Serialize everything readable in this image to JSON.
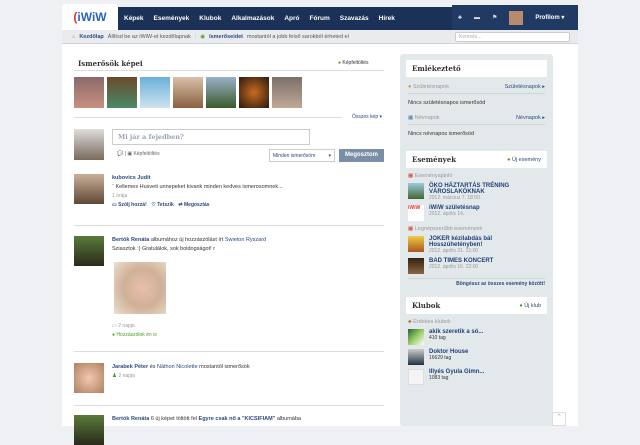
{
  "nav": {
    "logo": "iWiW",
    "items": [
      "Képek",
      "Események",
      "Klubok",
      "Alkalmazások",
      "Apró",
      "Fórum",
      "Szavazás",
      "Hírek"
    ],
    "profile": "Profilom ▾"
  },
  "sub": {
    "home_link": "Kezdőlap",
    "home_text": "Állítsd be az iWiW-et kezdőlapnak",
    "friends_link": "Ismerőseidet",
    "friends_text": "mostantól a jobb felső sarokból érheted el",
    "search_placeholder": "Keresés..."
  },
  "photos": {
    "title": "Ismerősök képei",
    "upload": "Képfeltöltés",
    "all": "Összes kép ▾"
  },
  "composer": {
    "placeholder": "Mi jár a fejedben?",
    "upload": "Képfeltöltés",
    "audience": "Minden ismerősöm",
    "share": "Megosztom"
  },
  "feed": [
    {
      "name": "kubovics Judit",
      "text": "Kellemes Husveti unnepeket kivank minden kedves ismerosomnek...",
      "time": "1 órája",
      "actions": [
        "Szólj hozzá!",
        "Tetszik",
        "Megosztás"
      ]
    },
    {
      "name": "Bertók Renáta",
      "mid": "albumához új hozzászólást írt",
      "other": "Swieton Ryszard",
      "text": "Sziasztok :) Gratulálok, sok boldogságot! r",
      "time": "2 napja",
      "comment": "Hozzászólok én is"
    },
    {
      "name": "Jarabek Péter",
      "mid": "és",
      "other": "Náthon Nicolette",
      "tail": "mostantól ismerősök",
      "time": "2 napja"
    },
    {
      "name": "Bertók Renáta",
      "mid": "6 új képet töltött fel",
      "other": "Egyre csak nő a \"KICSIFIAM\"",
      "tail": "albumába"
    }
  ],
  "side": {
    "reminder": {
      "title": "Emlékeztető",
      "birthdays": "Születésnapok",
      "birthdays_link": "Születésnapok ▸",
      "no_birthdays": "Nincs születésnapos ismerősöd",
      "namedays": "Névnapok",
      "namedays_link": "Névnapok ▸",
      "no_namedays": "Nincs névnapos ismerősöd"
    },
    "events": {
      "title": "Események",
      "new": "Új esemény",
      "recommend": "Eseményajánló",
      "popular": "Legnépszerűbb események",
      "browse": "Böngéssz az összes esemény között!",
      "list1": [
        {
          "t": "ÖKO HÁZTARTÁS TRÉNING VÁROSLAKÓKNAK",
          "d": "2012. március 7. 18:00"
        },
        {
          "t": "iWiW születésnap",
          "d": "2012. április 14."
        }
      ],
      "list2": [
        {
          "t": "JOKER kézilabdás bál Hosszúhetényben!",
          "d": "2012. április 21. 21:00"
        },
        {
          "t": "BAD TIMES KONCERT",
          "d": "2012. április 16. 22:00"
        }
      ]
    },
    "clubs": {
      "title": "Klubok",
      "new": "Új klub",
      "interesting": "Érdekes klubok",
      "list": [
        {
          "t": "akik szeretik a só...",
          "d": "410 tag"
        },
        {
          "t": "Doktor House",
          "d": "16629 tag"
        },
        {
          "t": "Illyés Gyula Gimn...",
          "d": "1083 tag"
        }
      ]
    }
  }
}
